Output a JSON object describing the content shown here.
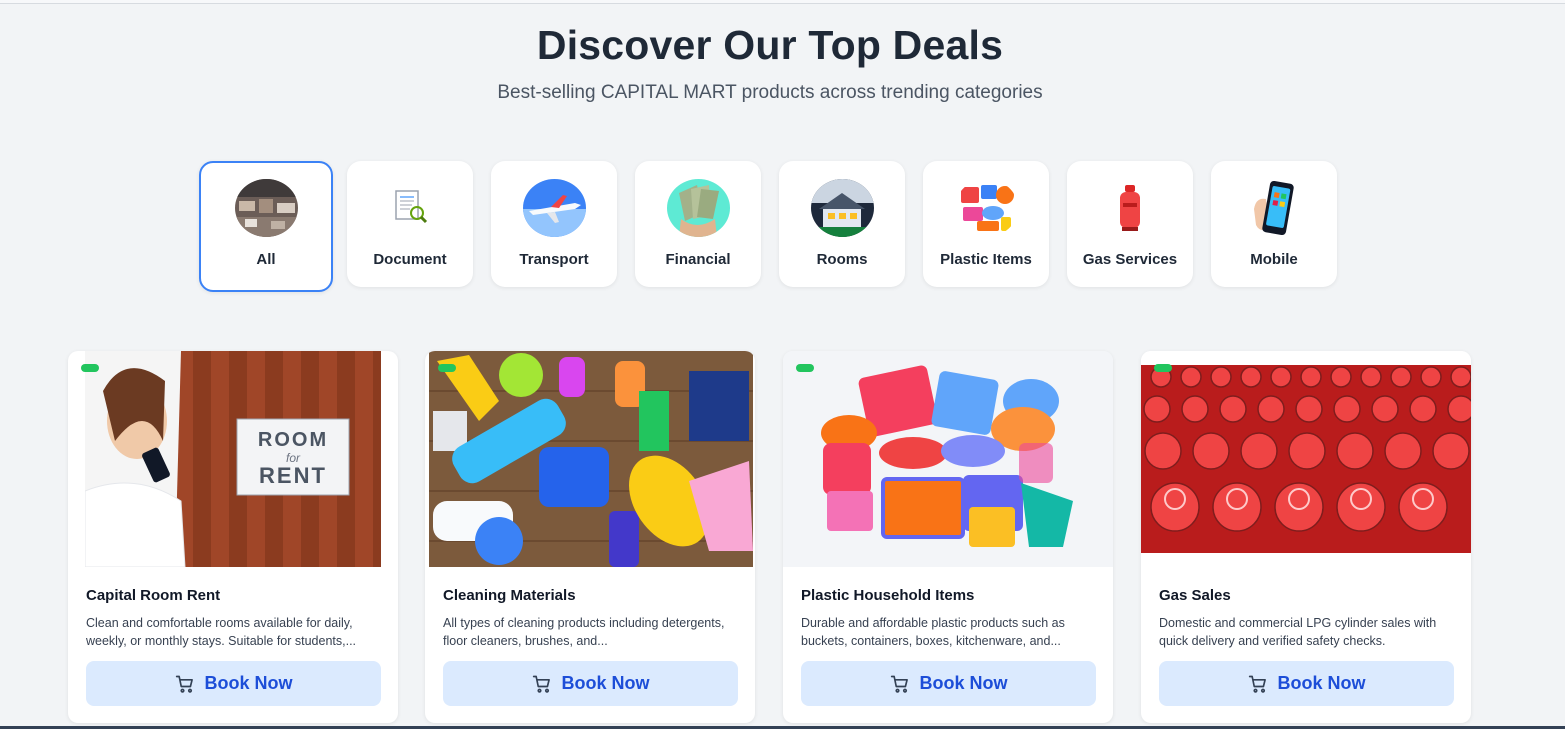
{
  "header": {
    "title": "Discover Our Top Deals",
    "subtitle": "Best-selling CAPITAL MART products across trending categories"
  },
  "categories": [
    {
      "label": "All",
      "icon": "store-interior-icon",
      "active": true
    },
    {
      "label": "Document",
      "icon": "document-search-icon",
      "active": false
    },
    {
      "label": "Transport",
      "icon": "airplane-icon",
      "active": false
    },
    {
      "label": "Financial",
      "icon": "cash-money-icon",
      "active": false
    },
    {
      "label": "Rooms",
      "icon": "house-icon",
      "active": false
    },
    {
      "label": "Plastic Items",
      "icon": "plastic-items-icon",
      "active": false
    },
    {
      "label": "Gas Services",
      "icon": "gas-cylinder-icon",
      "active": false
    },
    {
      "label": "Mobile",
      "icon": "smartphone-icon",
      "active": false
    }
  ],
  "products": [
    {
      "title": "Capital Room Rent",
      "description": "Clean and comfortable rooms available for daily, weekly, or monthly stays. Suitable for students,...",
      "image_text": [
        "ROOM",
        "for",
        "RENT"
      ],
      "cta": "Book Now"
    },
    {
      "title": "Cleaning Materials",
      "description": "All types of cleaning products including detergents, floor cleaners, brushes, and...",
      "cta": "Book Now"
    },
    {
      "title": "Plastic Household Items",
      "description": "Durable and affordable plastic products such as buckets, containers, boxes, kitchenware, and...",
      "cta": "Book Now"
    },
    {
      "title": "Gas Sales",
      "description": "Domestic and commercial LPG cylinder sales with quick delivery and verified safety checks.",
      "cta": "Book Now"
    }
  ],
  "colors": {
    "accent": "#3b82f6",
    "cta_bg": "#dbeafe",
    "cta_text": "#1d4ed8",
    "badge": "#22c55e"
  }
}
